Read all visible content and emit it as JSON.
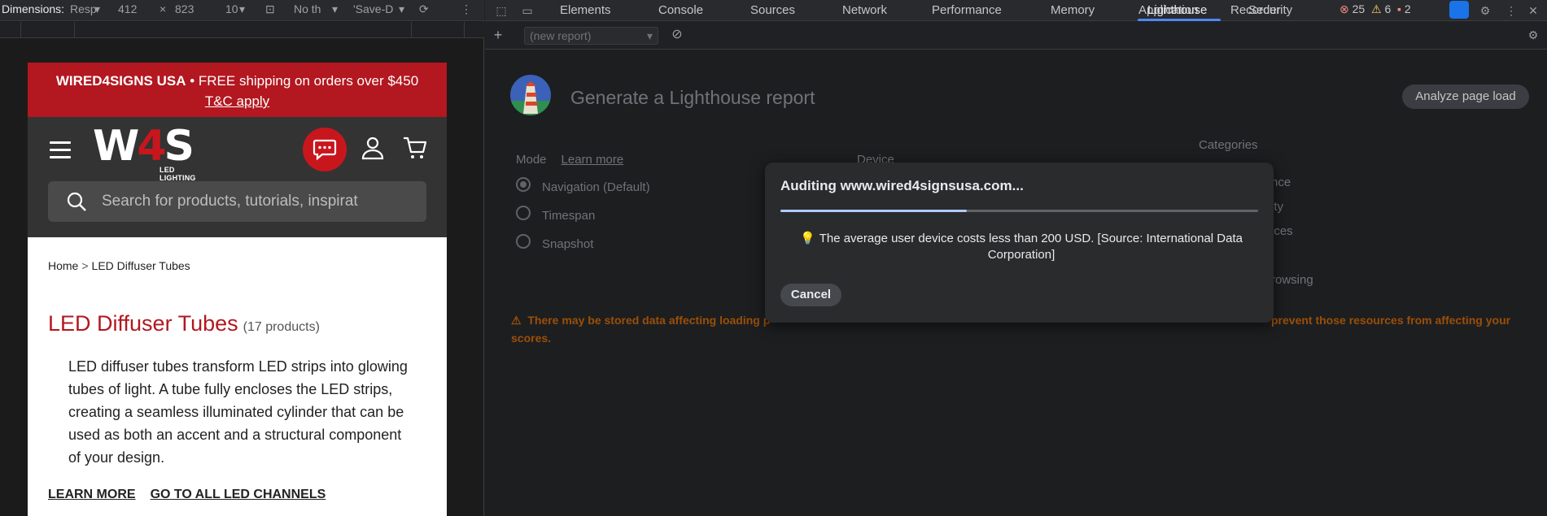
{
  "device_toolbar": {
    "dimensions_label": "Dimensions:",
    "device": "Resp",
    "width": "412",
    "times": "×",
    "height": "823",
    "zoom": "10",
    "throttle": "No th",
    "save": "'Save-D"
  },
  "site": {
    "promo_brand": "WIRED4SIGNS USA",
    "promo_text": " • FREE shipping on orders over $450",
    "promo_link": "T&C apply",
    "logo_text": "W4S",
    "logo_sub": "LED LIGHTING",
    "search_placeholder": "Search for products, tutorials, inspirat",
    "breadcrumb": {
      "home": "Home",
      "sep": ">",
      "current": "LED Diffuser Tubes"
    },
    "title": "LED Diffuser Tubes",
    "count": "(17 products)",
    "description": "LED diffuser tubes transform LED strips into glowing tubes of light. A tube fully encloses the LED strips, creating a seamless illuminated cylinder that can be used as both an accent and a structural component of your design.",
    "link_learn": "LEARN MORE",
    "link_channels": "GO TO ALL LED CHANNELS"
  },
  "devtools": {
    "tabs": [
      "Elements",
      "Console",
      "Sources",
      "Network",
      "Performance",
      "Memory",
      "Application",
      "Security",
      "Lighthouse",
      "Recorder"
    ],
    "active_tab": "Lighthouse",
    "errors": "25",
    "warnings": "6",
    "issues": "2",
    "report_select": "(new report)"
  },
  "lighthouse": {
    "title": "Generate a Lighthouse report",
    "analyze_button": "Analyze page load",
    "mode_label": "Mode",
    "learn_more": "Learn more",
    "device_label": "Device",
    "categories_label": "Categories",
    "modes": [
      "Navigation (Default)",
      "Timespan",
      "Snapshot"
    ],
    "categories_partial": [
      "nce",
      "ity",
      "ices",
      "rowsing"
    ],
    "warning": "There may be stored data affecting loading p",
    "warning_tail": "prevent those resources from affecting your",
    "warning_end": "scores."
  },
  "modal": {
    "title": "Auditing www.wired4signsusa.com...",
    "progress": 0.39,
    "tip": "The average user device costs less than 200 USD. [Source: International Data Corporation]",
    "cancel": "Cancel"
  },
  "colors": {
    "brand_red": "#b3171f",
    "devtools_bg": "#202124",
    "accent_blue": "#4c89f7",
    "warning_orange": "#9b4f08"
  }
}
